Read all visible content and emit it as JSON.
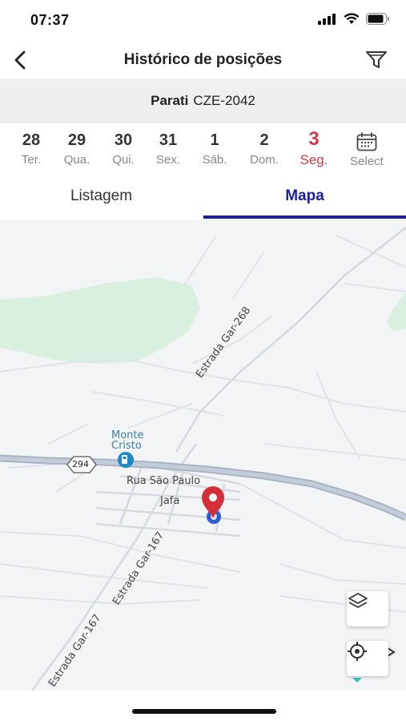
{
  "status": {
    "time": "07:37"
  },
  "header": {
    "title": "Histórico de posições"
  },
  "vehicle": {
    "name": "Parati",
    "plate": "CZE-2042"
  },
  "dates": [
    {
      "num": "28",
      "day": "Ter."
    },
    {
      "num": "29",
      "day": "Qua."
    },
    {
      "num": "30",
      "day": "Qui."
    },
    {
      "num": "31",
      "day": "Sex."
    },
    {
      "num": "1",
      "day": "Sáb."
    },
    {
      "num": "2",
      "day": "Dom."
    },
    {
      "num": "3",
      "day": "Seg.",
      "active": true
    }
  ],
  "select_label": "Select",
  "tabs": {
    "list": "Listagem",
    "map": "Mapa",
    "active": "map"
  },
  "map": {
    "labels": {
      "poi_line1": "Monte",
      "poi_line2": "Cristo",
      "highway": "294",
      "street1": "Rua São Paulo",
      "place": "Jafa",
      "road268": "Estrada Gar-268",
      "road167a": "Estrada Gar-167",
      "road167b": "Estrada Gar-167"
    },
    "colors": {
      "marker": "#d32f3a",
      "origin": "#2f5fd6",
      "highway": "#a9b3c6",
      "vegetation": "#d9f0e1"
    }
  }
}
